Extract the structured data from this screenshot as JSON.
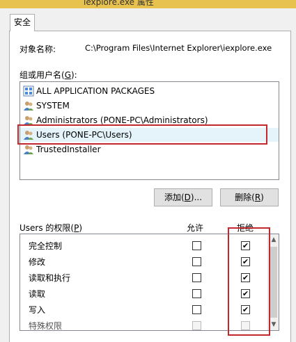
{
  "window": {
    "title_fragment": "iexplore.exe 属性"
  },
  "tabs": [
    {
      "label": "安全"
    }
  ],
  "object_name": {
    "label": "对象名称:",
    "value": "C:\\Program Files\\Internet Explorer\\iexplore.exe"
  },
  "group_label": {
    "text": "组或用户名(",
    "key": "G",
    "end": "):"
  },
  "users": [
    {
      "name": "ALL APPLICATION PACKAGES",
      "icon": "app-packages-icon"
    },
    {
      "name": "SYSTEM",
      "icon": "users-group-icon"
    },
    {
      "name": "Administrators (PONE-PC\\Administrators)",
      "icon": "users-group-icon"
    },
    {
      "name": "Users (PONE-PC\\Users)",
      "icon": "users-group-icon"
    },
    {
      "name": "TrustedInstaller",
      "icon": "users-group-icon"
    }
  ],
  "buttons": {
    "add": {
      "text": "添加(",
      "key": "D",
      "end": ")..."
    },
    "remove": {
      "text": "删除(",
      "key": "R",
      "end": ")"
    }
  },
  "permissions_header": {
    "label_prefix": "Users 的权限(",
    "key": "P",
    "label_end": ")",
    "allow": "允许",
    "deny": "拒绝"
  },
  "permissions": [
    {
      "name": "完全控制",
      "allow": false,
      "deny": true
    },
    {
      "name": "修改",
      "allow": false,
      "deny": true
    },
    {
      "name": "读取和执行",
      "allow": false,
      "deny": true
    },
    {
      "name": "读取",
      "allow": false,
      "deny": true
    },
    {
      "name": "写入",
      "allow": false,
      "deny": true
    },
    {
      "name": "特殊权限",
      "allow": false,
      "deny": false
    }
  ],
  "colors": {
    "highlight": "#c1272d",
    "selection": "#e5f3fb"
  }
}
